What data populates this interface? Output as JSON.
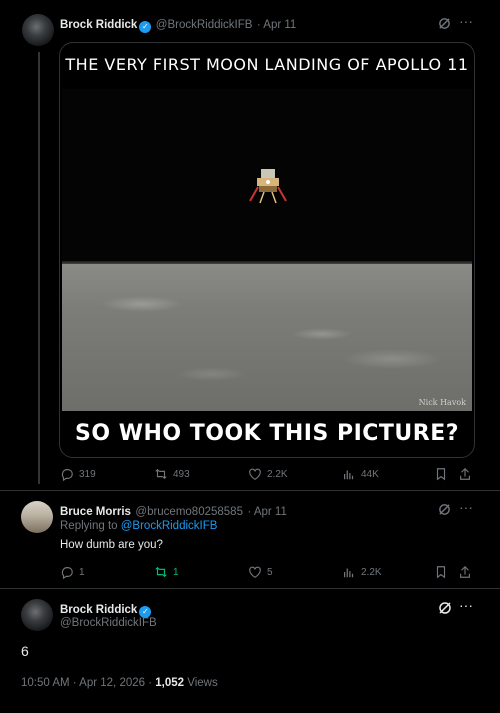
{
  "thread": {
    "tweet1": {
      "name": "Brock Riddick",
      "handle": "@BrockRiddickIFB",
      "date": "· Apr 11",
      "meme_top": "THE VERY FIRST MOON LANDING OF APOLLO 11",
      "meme_bottom": "SO WHO TOOK THIS PICTURE?",
      "watermark": "Nick Havok",
      "stats": {
        "replies": "319",
        "retweets": "493",
        "likes": "2.2K",
        "views": "44K"
      }
    },
    "tweet2": {
      "name": "Bruce Morris",
      "handle": "@brucemo80258585",
      "date": "· Apr 11",
      "replying_prefix": "Replying to",
      "replying_to": "@BrockRiddickIFB",
      "text": "How dumb are you?",
      "stats": {
        "replies": "1",
        "retweets": "1",
        "likes": "5",
        "views": "2.2K"
      }
    },
    "tweet3": {
      "name": "Brock Riddick",
      "handle": "@BrockRiddickIFB",
      "text": "6",
      "timestamp": "10:50 AM · Apr 12, 2026 · ",
      "views_count": "1,052",
      "views_label": " Views"
    }
  },
  "colors": {
    "accent": "#1d9bf0",
    "muted": "#71767b",
    "retweet_green": "#00ba7c",
    "background": "#000000"
  }
}
